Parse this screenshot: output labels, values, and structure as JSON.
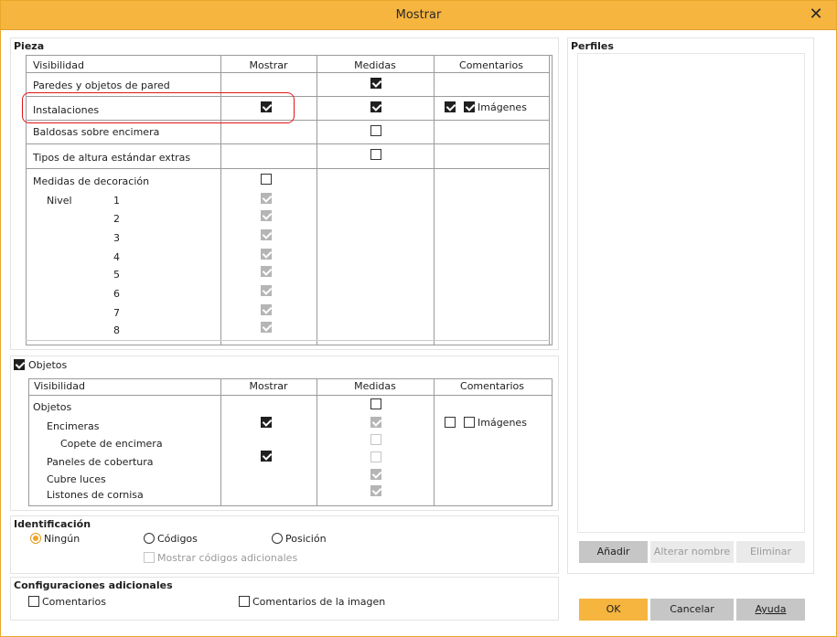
{
  "window": {
    "title": "Mostrar",
    "close_glyph": "✕"
  },
  "pieza": {
    "title": "Pieza",
    "headers": {
      "visibilidad": "Visibilidad",
      "mostrar": "Mostrar",
      "medidas": "Medidas",
      "comentarios": "Comentarios"
    },
    "rows": {
      "paredes": "Paredes y objetos de pared",
      "instalaciones": "Instalaciones",
      "imagenes": "Imágenes",
      "baldosas": "Baldosas sobre encimera",
      "tipos": "Tipos de altura estándar extras",
      "decoracion": "Medidas de decoración",
      "nivel": "Nivel"
    },
    "levels": [
      "1",
      "2",
      "3",
      "4",
      "5",
      "6",
      "7",
      "8"
    ]
  },
  "objetos": {
    "title": "Objetos",
    "checked": true,
    "headers": {
      "visibilidad": "Visibilidad",
      "mostrar": "Mostrar",
      "medidas": "Medidas",
      "comentarios": "Comentarios"
    },
    "rows": {
      "objetos": "Objetos",
      "encimeras": "Encimeras",
      "copete": "Copete de encimera",
      "paneles": "Paneles de cobertura",
      "cubre": "Cubre luces",
      "listones": "Listones de cornisa",
      "imagenes": "Imágenes"
    }
  },
  "identificacion": {
    "title": "Identificación",
    "options": [
      "Ningún",
      "Códigos",
      "Posición"
    ],
    "selected": "Ningún",
    "extra": "Mostrar códigos adicionales"
  },
  "config": {
    "title": "Configuraciones adicionales",
    "comentarios": "Comentarios",
    "comentarios_imagen": "Comentarios de la imagen"
  },
  "perfiles": {
    "title": "Perfiles",
    "add": "Añadir",
    "rename": "Alterar nombre",
    "delete": "Eliminar"
  },
  "footer": {
    "ok": "OK",
    "cancel": "Cancelar",
    "help": "Ayuda"
  },
  "colors": {
    "accent": "#f6b53f",
    "highlight": "#e0141a"
  }
}
